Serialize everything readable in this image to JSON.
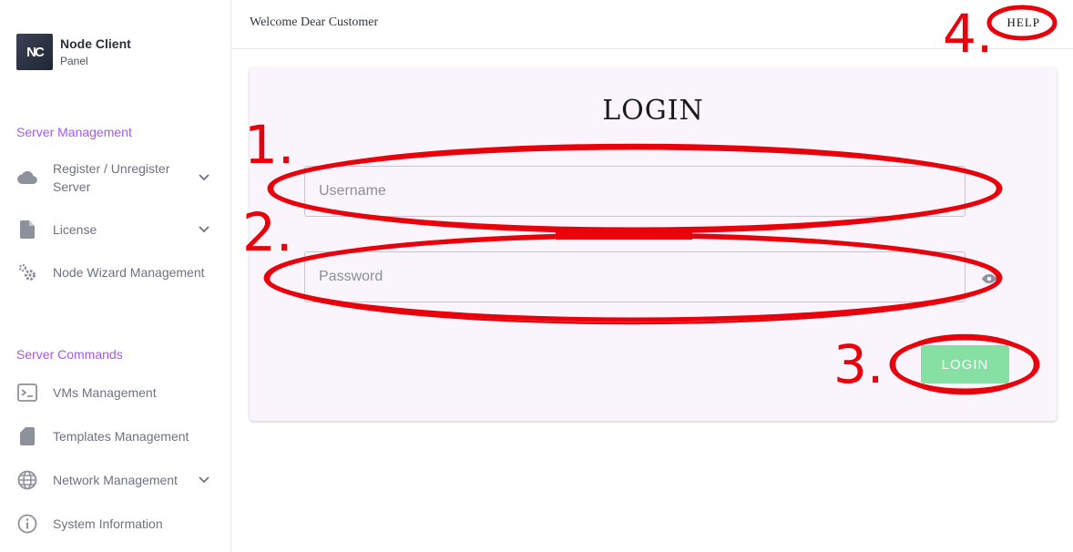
{
  "brand": {
    "logo_text": "NC",
    "title": "Node Client",
    "subtitle": "Panel"
  },
  "sidebar": {
    "sections": [
      {
        "title": "Server Management"
      },
      {
        "title": "Server Commands"
      }
    ],
    "items": [
      {
        "label": "Register / Unregister Server",
        "icon": "cloud-icon",
        "has_chevron": true
      },
      {
        "label": "License",
        "icon": "document-icon",
        "has_chevron": true
      },
      {
        "label": "Node Wizard Management",
        "icon": "gears-icon",
        "has_chevron": false
      },
      {
        "label": "VMs Management",
        "icon": "terminal-icon",
        "has_chevron": false
      },
      {
        "label": "Templates Management",
        "icon": "sd-card-icon",
        "has_chevron": false
      },
      {
        "label": "Network Management",
        "icon": "globe-icon",
        "has_chevron": true
      },
      {
        "label": "System Information",
        "icon": "info-icon",
        "has_chevron": false
      }
    ]
  },
  "header": {
    "welcome": "Welcome Dear Customer",
    "help": "HELP"
  },
  "login_form": {
    "title": "LOGIN",
    "username_placeholder": "Username",
    "password_placeholder": "Password",
    "submit_label": "LOGIN"
  },
  "annotations": [
    "1.",
    "2.",
    "3.",
    "4."
  ],
  "colors": {
    "accent": "#a855f7",
    "button": "#86e0a4",
    "card_bg": "#faf5fd",
    "annotation": "#e8000b"
  }
}
